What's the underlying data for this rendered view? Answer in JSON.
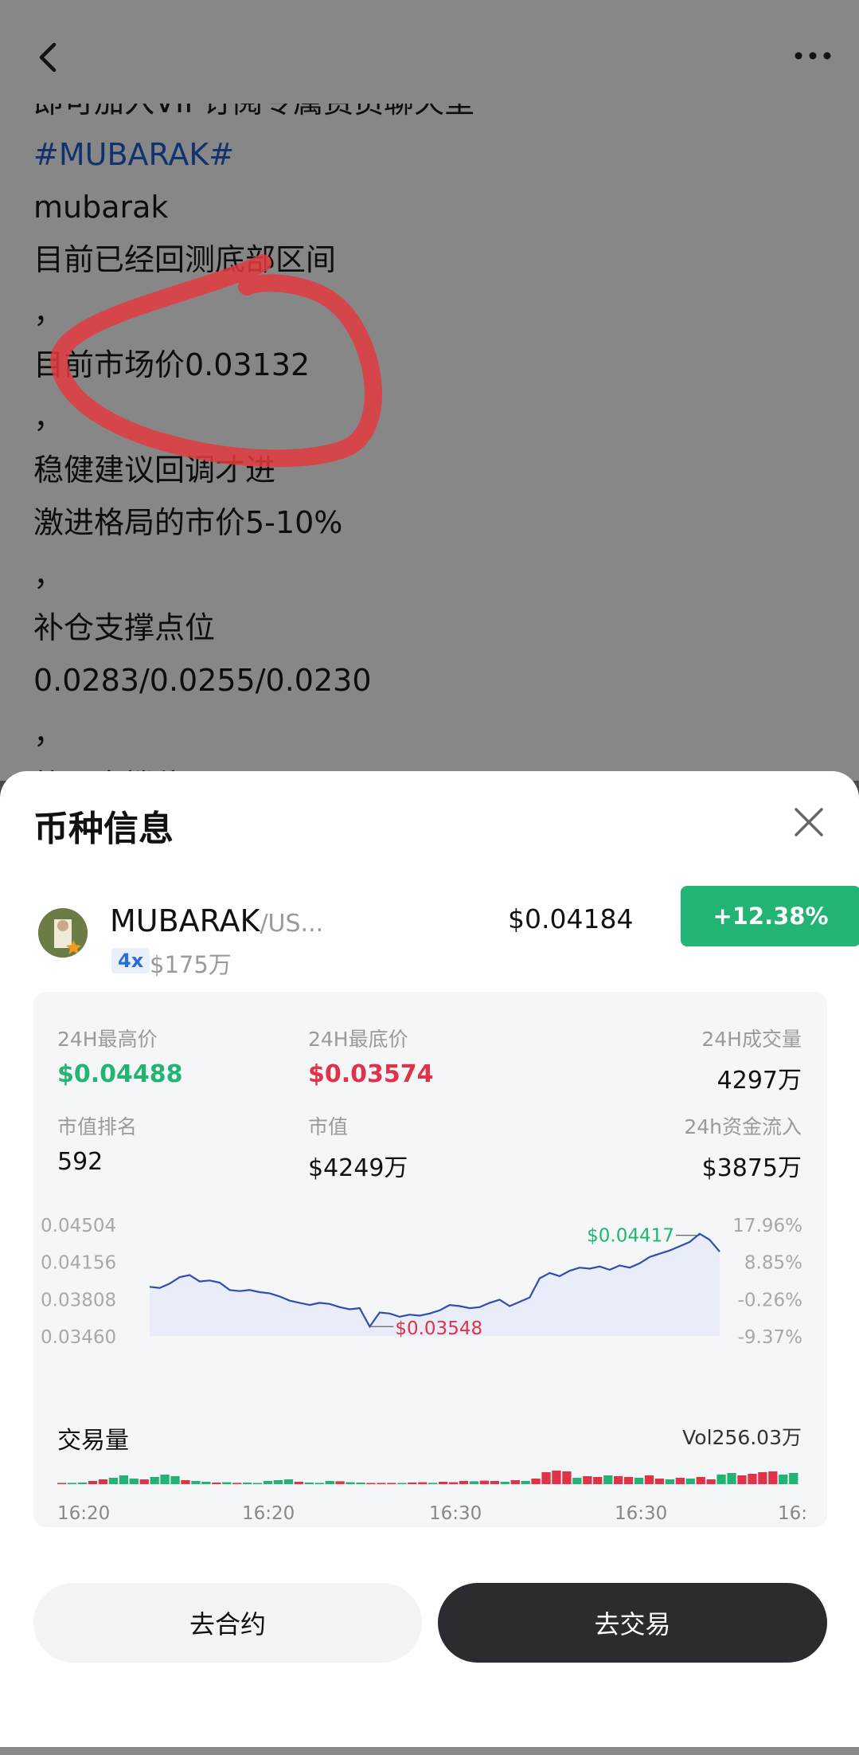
{
  "post": {
    "lines": [
      {
        "text": "即可加入VIP订阅专属费员聊天室",
        "style": "normal"
      },
      {
        "text": "#MUBARAK#",
        "style": "tag"
      },
      {
        "text": "mubarak",
        "style": "normal"
      },
      {
        "text": "目前已经回测底部区间",
        "style": "normal"
      },
      {
        "text": "，",
        "style": "normal"
      },
      {
        "text": "目前市场价0.03132",
        "style": "normal"
      },
      {
        "text": "，",
        "style": "normal"
      },
      {
        "text": "稳健建议回调才进",
        "style": "normal"
      },
      {
        "text": "激进格局的市价5-10%",
        "style": "normal"
      },
      {
        "text": "，",
        "style": "normal"
      },
      {
        "text": "补仓支撑点位",
        "style": "normal"
      },
      {
        "text": "0.0283/0.0255/0.0230",
        "style": "normal"
      },
      {
        "text": "，",
        "style": "normal"
      },
      {
        "text": "第一支撑位",
        "style": "normal"
      }
    ]
  },
  "sheet": {
    "title": "币种信息",
    "coin": {
      "name": "MUBARAK",
      "pair": "/US...",
      "leverage": "4x",
      "market_cap_small": "$175万",
      "price": "$0.04184",
      "change": "+12.38%"
    },
    "stats": {
      "high_label": "24H最高价",
      "high_value": "$0.04488",
      "low_label": "24H最底价",
      "low_value": "$0.03574",
      "volume_label": "24H成交量",
      "volume_value": "4297万",
      "rank_label": "市值排名",
      "rank_value": "592",
      "mcap_label": "市值",
      "mcap_value": "$4249万",
      "inflow_label": "24h资金流入",
      "inflow_value": "$3875万"
    },
    "volume_title": "交易量",
    "volume_total": "Vol256.03万",
    "buttons": {
      "contract": "去合约",
      "trade": "去交易"
    }
  },
  "chart_data": {
    "type": "line",
    "y_ticks": [
      "0.04504",
      "0.04156",
      "0.03808",
      "0.03460"
    ],
    "y_ticks_right": [
      "17.96%",
      "8.85%",
      "-0.26%",
      "-9.37%"
    ],
    "x_ticks": [
      "16:20",
      "16:20",
      "16:30",
      "16:30",
      "16:"
    ],
    "ylim": [
      0.0346,
      0.04504
    ],
    "max_label": "$0.04417",
    "min_label": "$0.03548",
    "line_color": "#2f4fb0",
    "values": [
      0.0392,
      0.0391,
      0.0395,
      0.0401,
      0.0403,
      0.0397,
      0.0398,
      0.0396,
      0.0389,
      0.0388,
      0.0389,
      0.0387,
      0.0386,
      0.0383,
      0.0379,
      0.0377,
      0.0375,
      0.0377,
      0.0376,
      0.0373,
      0.0371,
      0.0372,
      0.03548,
      0.0368,
      0.0367,
      0.0364,
      0.0366,
      0.0365,
      0.0367,
      0.037,
      0.0375,
      0.0374,
      0.0372,
      0.0373,
      0.0377,
      0.038,
      0.0374,
      0.0378,
      0.0382,
      0.04,
      0.0405,
      0.0402,
      0.0407,
      0.041,
      0.0409,
      0.0411,
      0.0408,
      0.0412,
      0.041,
      0.0414,
      0.042,
      0.0423,
      0.0426,
      0.043,
      0.0434,
      0.04417,
      0.0436,
      0.0425
    ],
    "volume": {
      "up_color": "#21b472",
      "down_color": "#e0334a",
      "bars": [
        {
          "h": 0.05,
          "dir": "down"
        },
        {
          "h": 0.08,
          "dir": "up"
        },
        {
          "h": 0.1,
          "dir": "up"
        },
        {
          "h": 0.2,
          "dir": "down"
        },
        {
          "h": 0.3,
          "dir": "down"
        },
        {
          "h": 0.4,
          "dir": "up"
        },
        {
          "h": 0.55,
          "dir": "up"
        },
        {
          "h": 0.35,
          "dir": "up"
        },
        {
          "h": 0.3,
          "dir": "down"
        },
        {
          "h": 0.45,
          "dir": "up"
        },
        {
          "h": 0.6,
          "dir": "up"
        },
        {
          "h": 0.5,
          "dir": "up"
        },
        {
          "h": 0.25,
          "dir": "down"
        },
        {
          "h": 0.2,
          "dir": "up"
        },
        {
          "h": 0.15,
          "dir": "up"
        },
        {
          "h": 0.1,
          "dir": "down"
        },
        {
          "h": 0.12,
          "dir": "up"
        },
        {
          "h": 0.08,
          "dir": "down"
        },
        {
          "h": 0.1,
          "dir": "up"
        },
        {
          "h": 0.06,
          "dir": "up"
        },
        {
          "h": 0.2,
          "dir": "up"
        },
        {
          "h": 0.25,
          "dir": "up"
        },
        {
          "h": 0.3,
          "dir": "up"
        },
        {
          "h": 0.15,
          "dir": "down"
        },
        {
          "h": 0.1,
          "dir": "up"
        },
        {
          "h": 0.08,
          "dir": "up"
        },
        {
          "h": 0.2,
          "dir": "up"
        },
        {
          "h": 0.18,
          "dir": "down"
        },
        {
          "h": 0.12,
          "dir": "up"
        },
        {
          "h": 0.1,
          "dir": "up"
        },
        {
          "h": 0.06,
          "dir": "down"
        },
        {
          "h": 0.05,
          "dir": "down"
        },
        {
          "h": 0.04,
          "dir": "down"
        },
        {
          "h": 0.06,
          "dir": "up"
        },
        {
          "h": 0.1,
          "dir": "down"
        },
        {
          "h": 0.12,
          "dir": "down"
        },
        {
          "h": 0.08,
          "dir": "up"
        },
        {
          "h": 0.15,
          "dir": "down"
        },
        {
          "h": 0.12,
          "dir": "down"
        },
        {
          "h": 0.2,
          "dir": "down"
        },
        {
          "h": 0.18,
          "dir": "up"
        },
        {
          "h": 0.22,
          "dir": "down"
        },
        {
          "h": 0.2,
          "dir": "down"
        },
        {
          "h": 0.15,
          "dir": "up"
        },
        {
          "h": 0.25,
          "dir": "down"
        },
        {
          "h": 0.2,
          "dir": "up"
        },
        {
          "h": 0.35,
          "dir": "down"
        },
        {
          "h": 0.75,
          "dir": "down"
        },
        {
          "h": 0.85,
          "dir": "down"
        },
        {
          "h": 0.8,
          "dir": "down"
        },
        {
          "h": 0.4,
          "dir": "up"
        },
        {
          "h": 0.5,
          "dir": "down"
        },
        {
          "h": 0.45,
          "dir": "down"
        },
        {
          "h": 0.55,
          "dir": "up"
        },
        {
          "h": 0.5,
          "dir": "down"
        },
        {
          "h": 0.45,
          "dir": "down"
        },
        {
          "h": 0.4,
          "dir": "up"
        },
        {
          "h": 0.55,
          "dir": "down"
        },
        {
          "h": 0.35,
          "dir": "down"
        },
        {
          "h": 0.3,
          "dir": "up"
        },
        {
          "h": 0.4,
          "dir": "down"
        },
        {
          "h": 0.35,
          "dir": "up"
        },
        {
          "h": 0.45,
          "dir": "down"
        },
        {
          "h": 0.3,
          "dir": "down"
        },
        {
          "h": 0.6,
          "dir": "up"
        },
        {
          "h": 0.7,
          "dir": "up"
        },
        {
          "h": 0.55,
          "dir": "down"
        },
        {
          "h": 0.65,
          "dir": "down"
        },
        {
          "h": 0.75,
          "dir": "down"
        },
        {
          "h": 0.8,
          "dir": "down"
        },
        {
          "h": 0.6,
          "dir": "up"
        },
        {
          "h": 0.7,
          "dir": "up"
        }
      ]
    }
  }
}
